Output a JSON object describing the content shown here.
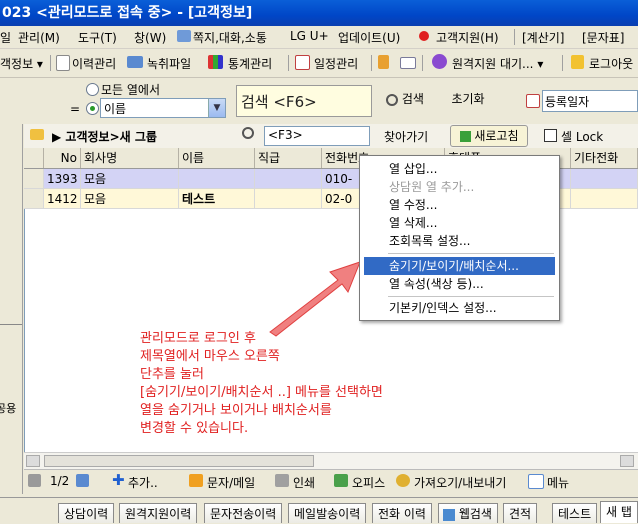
{
  "window": {
    "title": "023 <관리모드로 접속 중> - [고객정보]"
  },
  "menu": [
    {
      "label": "일"
    },
    {
      "label": "관리(M)"
    },
    {
      "label": "도구(T)"
    },
    {
      "label": "창(W)"
    },
    {
      "label": "쪽지,대화,소통"
    },
    {
      "label": "LG U+"
    },
    {
      "label": "업데이트(U)"
    },
    {
      "label": "고객지원(H)"
    },
    {
      "label": "[계산기]"
    },
    {
      "label": "[문자표]"
    }
  ],
  "toolbar": [
    {
      "label": "객정보 ▾"
    },
    {
      "label": "이력관리"
    },
    {
      "label": "녹취파일"
    },
    {
      "label": "통계관리"
    },
    {
      "label": "일정관리"
    },
    {
      "label": "원격지원 대기... ▾"
    },
    {
      "label": "로그아웃"
    }
  ],
  "search": {
    "radio_all": "모든 열에서",
    "eq_label": "=",
    "column_value": "이름",
    "input_value": "검색 <F6>",
    "search_button": "검색",
    "reset_button": "초기화",
    "date_value": "등록일자"
  },
  "path": {
    "label": "고객정보>새 그룹",
    "find_value": "<F3>",
    "find_button": "찾아가기",
    "refresh_button": "새로고침",
    "cell_lock": "셀 Lock"
  },
  "grid": {
    "columns": [
      "No",
      "회사명",
      "이름",
      "직급",
      "전화번호",
      "휴대폰",
      "기타전화"
    ],
    "rows": [
      [
        "1393",
        "모음",
        "",
        "",
        "010-",
        "",
        ""
      ],
      [
        "1412",
        "모음",
        "테스트",
        "",
        "02-0",
        "",
        ""
      ]
    ]
  },
  "context_menu": [
    {
      "label": "열 삽입...",
      "disabled": false
    },
    {
      "label": "상담원 열 추가...",
      "disabled": true
    },
    {
      "label": "열 수정...",
      "disabled": false
    },
    {
      "label": "열 삭제...",
      "disabled": false
    },
    {
      "label": "조회목록 설정...",
      "disabled": false
    },
    {
      "label": "숨기기/보이기/배치순서...",
      "disabled": false,
      "highlighted": true
    },
    {
      "label": "열 속성(색상 등)...",
      "disabled": false
    },
    {
      "label": "기본키/인덱스 설정...",
      "disabled": false
    }
  ],
  "annotation": {
    "lines": [
      "관리모드로 로그인 후",
      "제목열에서 마우스 오른쪽",
      "단추를 눌러",
      "[숨기기/보이기/배치순서 ..] 메뉴를 선택하면",
      "열을 숨기거나 보이거나 배치순서를",
      "변경할 수 있습니다."
    ]
  },
  "left_panel": {
    "label": "공용"
  },
  "bottom": {
    "page": "1/2",
    "add": "추가..",
    "sms": "문자/메일",
    "print": "인쇄",
    "office": "오피스",
    "import": "가져오기/내보내기",
    "menu": "메뉴"
  },
  "tabs": [
    "상담이력",
    "원격지원이력",
    "문자전송이력",
    "메일발송이력",
    "전화 이력",
    "웹검색",
    "견적",
    "테스트",
    "새 탭"
  ],
  "colors": {
    "accent": "#316ac5",
    "annotation": "#e02020",
    "row_selected": "#d3d3f5",
    "row_alt": "#fff8d8"
  }
}
